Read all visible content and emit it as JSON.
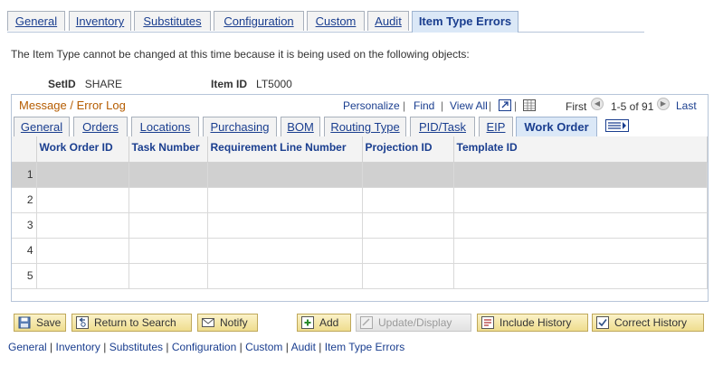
{
  "top_tabs": [
    {
      "label": "General",
      "active": false
    },
    {
      "label": "Inventory",
      "active": false
    },
    {
      "label": "Substitutes",
      "active": false
    },
    {
      "label": "Configuration",
      "active": false
    },
    {
      "label": "Custom",
      "active": false
    },
    {
      "label": "Audit",
      "active": false
    },
    {
      "label": "Item Type Errors",
      "active": true
    }
  ],
  "message": "The Item Type cannot be changed at this time because it is being used on the following objects:",
  "setid": {
    "label": "SetID",
    "value": "SHARE"
  },
  "item_id": {
    "label": "Item ID",
    "value": "LT5000"
  },
  "grid": {
    "title_a": "Message",
    "title_sep": "/",
    "title_b": "Error Log",
    "personalize": "Personalize",
    "find": "Find",
    "view_all": "View All",
    "first": "First",
    "range": "1-5 of 91",
    "last": "Last",
    "tabs": [
      {
        "label": "General",
        "active": false
      },
      {
        "label": "Orders",
        "active": false
      },
      {
        "label": "Locations",
        "active": false
      },
      {
        "label": "Purchasing",
        "active": false
      },
      {
        "label": "BOM",
        "active": false
      },
      {
        "label": "Routing Type",
        "active": false
      },
      {
        "label": "PID/Task",
        "active": false
      },
      {
        "label": "EIP",
        "active": false
      },
      {
        "label": "Work Order",
        "active": true
      }
    ],
    "columns": [
      "Work Order ID",
      "Task Number",
      "Requirement Line Number",
      "Projection ID",
      "Template ID"
    ],
    "rows": [
      "1",
      "2",
      "3",
      "4",
      "5"
    ]
  },
  "buttons": {
    "save": "Save",
    "return": "Return to Search",
    "notify": "Notify",
    "add": "Add",
    "update": "Update/Display",
    "include_history": "Include History",
    "correct_history": "Correct History"
  },
  "footer_links": [
    "General",
    "Inventory",
    "Substitutes",
    "Configuration",
    "Custom",
    "Audit",
    "Item Type Errors"
  ],
  "footer_sep": "|",
  "colors": {
    "link": "#1a3e8f",
    "title": "#b55c00",
    "button": "#efdd8e"
  }
}
